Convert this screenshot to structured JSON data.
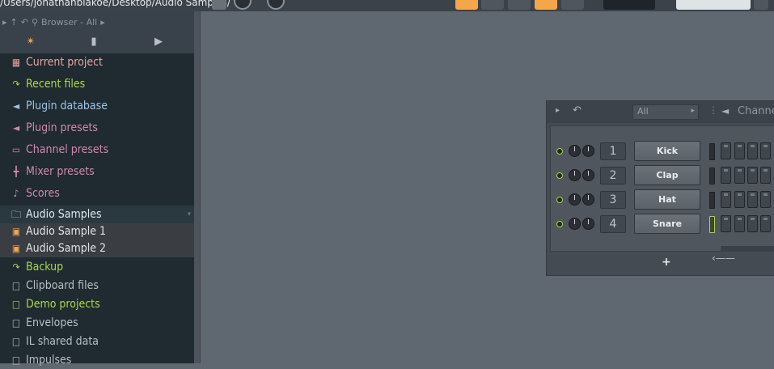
{
  "topbar": {
    "path": "/Users/jonathanblakoe/Desktop/Audio Samples/"
  },
  "browser": {
    "breadcrumb": "Browser - All",
    "items": [
      {
        "label": "Current project",
        "icon": "document-icon",
        "color": "#e6a2a0"
      },
      {
        "label": "Recent files",
        "icon": "folder-link-icon",
        "color": "#a8d84a"
      },
      {
        "label": "Plugin database",
        "icon": "speaker-icon",
        "color": "#9fc2e2"
      },
      {
        "label": "Plugin presets",
        "icon": "speaker-icon",
        "color": "#d087b0"
      },
      {
        "label": "Channel presets",
        "icon": "channel-icon",
        "color": "#d087b0"
      },
      {
        "label": "Mixer presets",
        "icon": "mixer-icon",
        "color": "#d087b0"
      },
      {
        "label": "Scores",
        "icon": "note-icon",
        "color": "#d087b0"
      },
      {
        "label": "Audio Samples",
        "icon": "folder-open-icon",
        "color": "#dfe6ea"
      },
      {
        "label": "Audio Sample 1",
        "icon": "audio-file-icon",
        "color": "#dfe2e5"
      },
      {
        "label": "Audio Sample 2",
        "icon": "audio-file-icon",
        "color": "#dfe2e5"
      },
      {
        "label": "Backup",
        "icon": "folder-link-icon",
        "color": "#a8d84a"
      },
      {
        "label": "Clipboard files",
        "icon": "folder-open-icon",
        "color": "#b7bec4"
      },
      {
        "label": "Demo projects",
        "icon": "folder-open-icon",
        "color": "#a8d84a"
      },
      {
        "label": "Envelopes",
        "icon": "folder-icon",
        "color": "#b7bec4"
      },
      {
        "label": "IL shared data",
        "icon": "folder-open-icon",
        "color": "#b7bec4"
      },
      {
        "label": "Impulses",
        "icon": "folder-open-icon",
        "color": "#b7bec4"
      }
    ]
  },
  "rack": {
    "filter": "All",
    "title": "Channe",
    "channels": [
      {
        "number": "1",
        "name": "Kick"
      },
      {
        "number": "2",
        "name": "Clap"
      },
      {
        "number": "3",
        "name": "Hat"
      },
      {
        "number": "4",
        "name": "Snare"
      }
    ],
    "add_label": "+"
  },
  "colors": {
    "accent_green": "#a8d84a",
    "toolbar_orange": "#f3a64a"
  }
}
